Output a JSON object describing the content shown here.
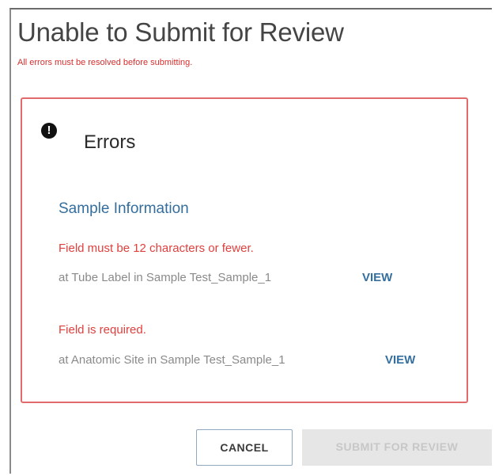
{
  "dialog": {
    "title": "Unable to Submit for Review",
    "subtitle": "All errors must be resolved before submitting."
  },
  "errors_panel": {
    "icon": "exclamation-circle-icon",
    "heading": "Errors",
    "section_title": "Sample Information",
    "items": [
      {
        "message": "Field must be 12 characters or fewer.",
        "location": "at Tube Label in Sample Test_Sample_1",
        "link_label": "VIEW"
      },
      {
        "message": "Field is required.",
        "location": "at Anatomic Site in Sample Test_Sample_1",
        "link_label": "VIEW"
      }
    ]
  },
  "actions": {
    "cancel_label": "CANCEL",
    "submit_label": "SUBMIT FOR REVIEW"
  },
  "colors": {
    "error_red": "#e0403e",
    "link_blue": "#356f9f",
    "panel_border": "#e36a6a",
    "disabled_bg": "#e6e6e6"
  }
}
